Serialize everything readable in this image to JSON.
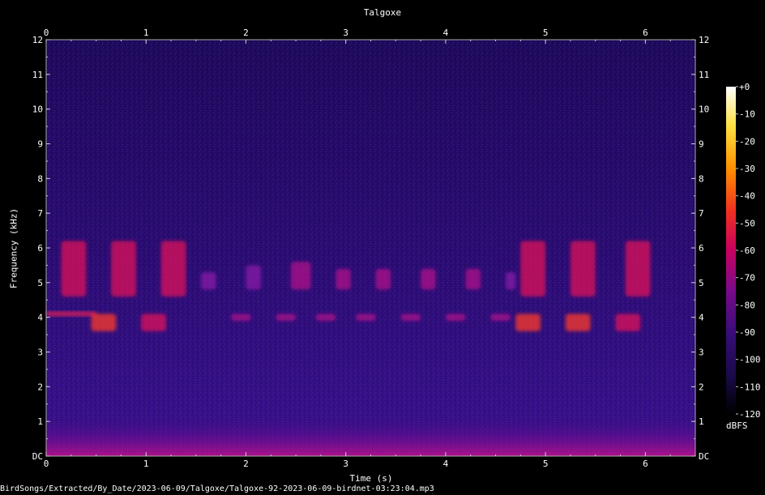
{
  "window": {
    "title": "Talgoxe",
    "file_path": "BirdSongs/Extracted/By_Date/2023-06-09/Talgoxe/Talgoxe-92-2023-06-09-birdnet-03:23:04.mp3"
  },
  "chart_data": {
    "type": "heatmap",
    "title": "Talgoxe",
    "xlabel": "Time (s)",
    "ylabel": "Frequency (kHz)",
    "xlim": [
      0,
      6.5
    ],
    "ylim": [
      0,
      12
    ],
    "x_ticks": [
      "0",
      "1",
      "2",
      "3",
      "4",
      "5",
      "6"
    ],
    "y_ticks": [
      "DC",
      "1",
      "2",
      "3",
      "4",
      "5",
      "6",
      "7",
      "8",
      "9",
      "10",
      "11",
      "12"
    ],
    "colorbar": {
      "label": "dBFS",
      "range": [
        -120,
        0
      ],
      "ticks": [
        "+0",
        "-10",
        "-20",
        "-30",
        "-40",
        "-50",
        "-60",
        "-70",
        "-80",
        "-90",
        "-100",
        "-110",
        "-120"
      ],
      "colors": [
        "#000000",
        "#1a0a4a",
        "#3a0c7a",
        "#7a0a8a",
        "#c80060",
        "#f03020",
        "#ff9000",
        "#ffe040",
        "#ffffff"
      ]
    },
    "background_level_dbfs": -95,
    "low_frequency_band": {
      "freq_khz": [
        0,
        1.2
      ],
      "level_dbfs": -70
    },
    "tone_band": {
      "freq_khz": 4.1,
      "time_s": [
        0,
        0.5
      ],
      "level_dbfs": -60
    },
    "events": [
      {
        "time_s": 0.15,
        "duration_s": 0.25,
        "freq_range_khz": [
          4.6,
          6.2
        ],
        "level_dbfs": -65
      },
      {
        "time_s": 0.45,
        "duration_s": 0.25,
        "freq_range_khz": [
          3.6,
          4.1
        ],
        "level_dbfs": -55
      },
      {
        "time_s": 0.65,
        "duration_s": 0.25,
        "freq_range_khz": [
          4.6,
          6.2
        ],
        "level_dbfs": -65
      },
      {
        "time_s": 0.95,
        "duration_s": 0.25,
        "freq_range_khz": [
          3.6,
          4.1
        ],
        "level_dbfs": -58
      },
      {
        "time_s": 1.15,
        "duration_s": 0.25,
        "freq_range_khz": [
          4.6,
          6.2
        ],
        "level_dbfs": -65
      },
      {
        "time_s": 1.55,
        "duration_s": 0.15,
        "freq_range_khz": [
          4.8,
          5.3
        ],
        "level_dbfs": -80
      },
      {
        "time_s": 1.85,
        "duration_s": 0.2,
        "freq_range_khz": [
          3.9,
          4.1
        ],
        "level_dbfs": -70
      },
      {
        "time_s": 2.0,
        "duration_s": 0.15,
        "freq_range_khz": [
          4.8,
          5.5
        ],
        "level_dbfs": -78
      },
      {
        "time_s": 2.3,
        "duration_s": 0.2,
        "freq_range_khz": [
          3.9,
          4.1
        ],
        "level_dbfs": -72
      },
      {
        "time_s": 2.45,
        "duration_s": 0.2,
        "freq_range_khz": [
          4.8,
          5.6
        ],
        "level_dbfs": -75
      },
      {
        "time_s": 2.7,
        "duration_s": 0.2,
        "freq_range_khz": [
          3.9,
          4.1
        ],
        "level_dbfs": -72
      },
      {
        "time_s": 2.9,
        "duration_s": 0.15,
        "freq_range_khz": [
          4.8,
          5.4
        ],
        "level_dbfs": -76
      },
      {
        "time_s": 3.1,
        "duration_s": 0.2,
        "freq_range_khz": [
          3.9,
          4.1
        ],
        "level_dbfs": -72
      },
      {
        "time_s": 3.3,
        "duration_s": 0.15,
        "freq_range_khz": [
          4.8,
          5.4
        ],
        "level_dbfs": -76
      },
      {
        "time_s": 3.55,
        "duration_s": 0.2,
        "freq_range_khz": [
          3.9,
          4.1
        ],
        "level_dbfs": -72
      },
      {
        "time_s": 3.75,
        "duration_s": 0.15,
        "freq_range_khz": [
          4.8,
          5.4
        ],
        "level_dbfs": -76
      },
      {
        "time_s": 4.0,
        "duration_s": 0.2,
        "freq_range_khz": [
          3.9,
          4.1
        ],
        "level_dbfs": -74
      },
      {
        "time_s": 4.2,
        "duration_s": 0.15,
        "freq_range_khz": [
          4.8,
          5.4
        ],
        "level_dbfs": -76
      },
      {
        "time_s": 4.45,
        "duration_s": 0.2,
        "freq_range_khz": [
          3.9,
          4.1
        ],
        "level_dbfs": -72
      },
      {
        "time_s": 4.6,
        "duration_s": 0.1,
        "freq_range_khz": [
          4.8,
          5.3
        ],
        "level_dbfs": -78
      },
      {
        "time_s": 4.7,
        "duration_s": 0.25,
        "freq_range_khz": [
          3.6,
          4.1
        ],
        "level_dbfs": -55
      },
      {
        "time_s": 4.75,
        "duration_s": 0.25,
        "freq_range_khz": [
          4.6,
          6.2
        ],
        "level_dbfs": -65
      },
      {
        "time_s": 5.2,
        "duration_s": 0.25,
        "freq_range_khz": [
          3.6,
          4.1
        ],
        "level_dbfs": -55
      },
      {
        "time_s": 5.25,
        "duration_s": 0.25,
        "freq_range_khz": [
          4.6,
          6.2
        ],
        "level_dbfs": -65
      },
      {
        "time_s": 5.7,
        "duration_s": 0.25,
        "freq_range_khz": [
          3.6,
          4.1
        ],
        "level_dbfs": -58
      },
      {
        "time_s": 5.8,
        "duration_s": 0.25,
        "freq_range_khz": [
          4.6,
          6.2
        ],
        "level_dbfs": -65
      }
    ]
  }
}
